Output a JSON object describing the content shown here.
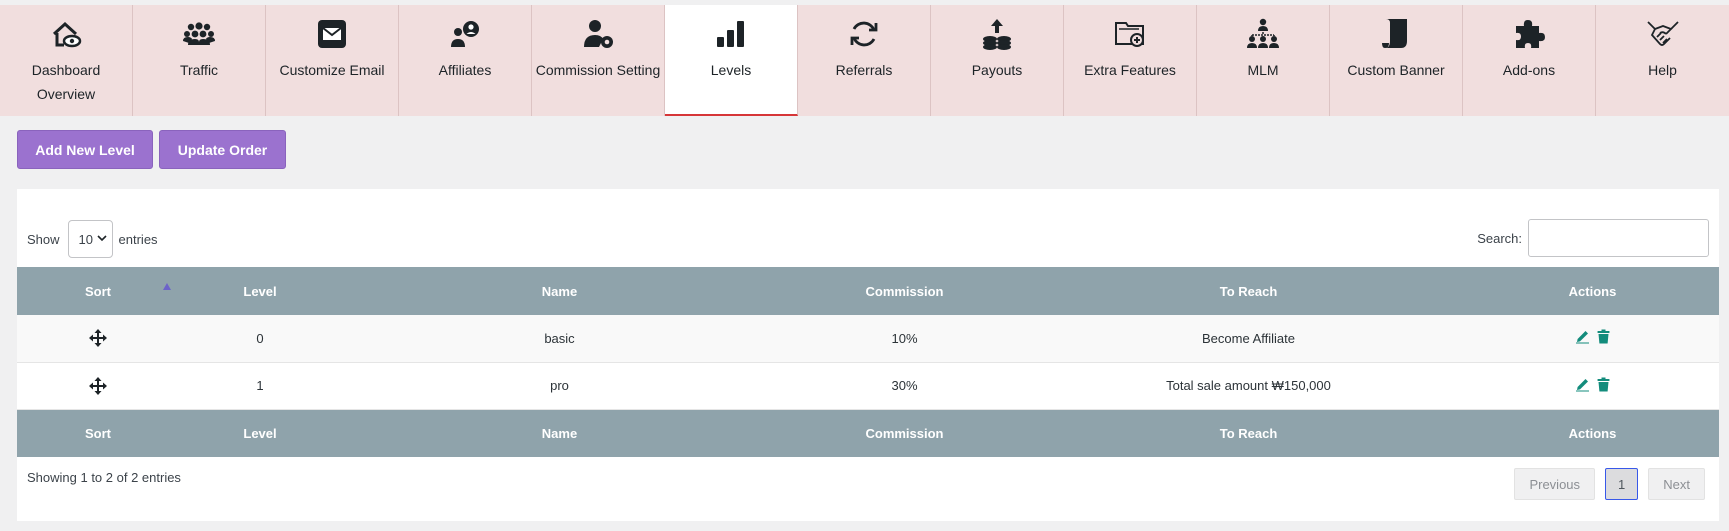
{
  "tabs": [
    {
      "label": "Dashboard Overview",
      "icon": "dashboard-overview-icon"
    },
    {
      "label": "Traffic",
      "icon": "traffic-users-icon"
    },
    {
      "label": "Customize Email",
      "icon": "email-icon"
    },
    {
      "label": "Affiliates",
      "icon": "affiliates-icon"
    },
    {
      "label": "Commission Setting",
      "icon": "commission-setting-icon"
    },
    {
      "label": "Levels",
      "icon": "levels-bar-icon",
      "active": true
    },
    {
      "label": "Referrals",
      "icon": "referrals-refresh-icon"
    },
    {
      "label": "Payouts",
      "icon": "payouts-coins-icon"
    },
    {
      "label": "Extra Features",
      "icon": "extra-features-icon"
    },
    {
      "label": "MLM",
      "icon": "mlm-network-icon"
    },
    {
      "label": "Custom Banner",
      "icon": "custom-banner-icon"
    },
    {
      "label": "Add-ons",
      "icon": "addons-puzzle-icon"
    },
    {
      "label": "Help",
      "icon": "help-handshake-icon"
    }
  ],
  "actions": {
    "add_new_level": "Add New Level",
    "update_order": "Update Order"
  },
  "table_controls": {
    "show_label": "Show",
    "entries_label": "entries",
    "length_value": "10",
    "search_label": "Search:",
    "search_value": ""
  },
  "table": {
    "headers": [
      "Sort",
      "Level",
      "Name",
      "Commission",
      "To Reach",
      "Actions"
    ],
    "rows": [
      {
        "level": "0",
        "name": "basic",
        "commission": "10%",
        "to_reach": "Become Affiliate"
      },
      {
        "level": "1",
        "name": "pro",
        "commission": "30%",
        "to_reach": "Total sale amount ₩150,000"
      }
    ]
  },
  "footer": {
    "info": "Showing 1 to 2 of 2 entries",
    "previous": "Previous",
    "current_page": "1",
    "next": "Next"
  },
  "colors": {
    "tab_bg": "#f1dede",
    "active_tab_underline": "#d63638",
    "button_purple": "#9b72cf",
    "table_header": "#8fa3ab",
    "action_icon_teal": "#138c7c"
  }
}
